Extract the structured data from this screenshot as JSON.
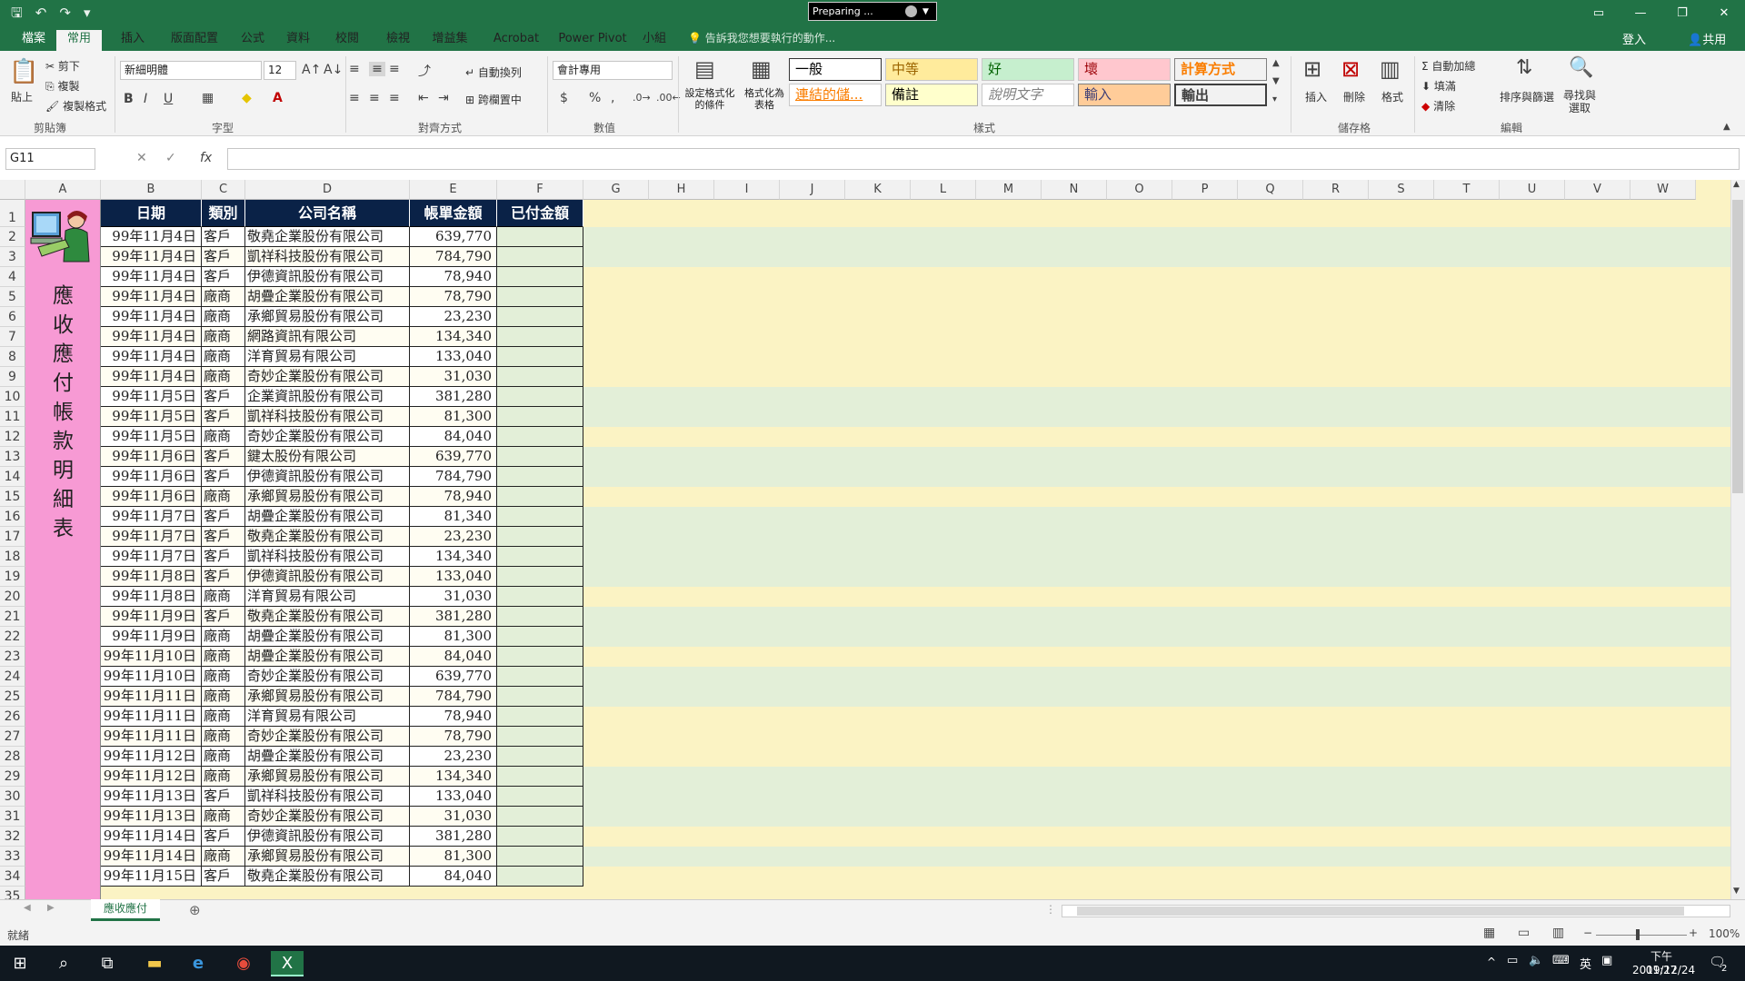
{
  "titlebar": {
    "preparing": "Preparing ...",
    "qat": [
      "save-icon",
      "undo-icon",
      "redo-icon",
      "customize-icon"
    ]
  },
  "tabs": [
    "檔案",
    "常用",
    "插入",
    "版面配置",
    "公式",
    "資料",
    "校閱",
    "檢視",
    "增益集",
    "Acrobat",
    "Power Pivot",
    "小組"
  ],
  "active_tab": "常用",
  "tellme": "告訴我您想要執行的動作...",
  "login": "登入",
  "share": "共用",
  "ribbon": {
    "clipboard": {
      "paste": "貼上",
      "cut": "剪下",
      "copy": "複製",
      "format_painter": "複製格式",
      "label": "剪貼簿"
    },
    "font": {
      "name": "新細明體",
      "size": "12",
      "bold": "B",
      "italic": "I",
      "underline": "U",
      "label": "字型"
    },
    "alignment": {
      "wrap": "自動換列",
      "merge": "跨欄置中",
      "label": "對齊方式"
    },
    "number": {
      "format": "會計專用",
      "currency": "$",
      "percent": "%",
      "comma": ",",
      "label": "數值"
    },
    "styles": {
      "conditional": "設定格式化的條件",
      "as_table": "格式化為表格",
      "cells": [
        "一般",
        "中等",
        "好",
        "壞",
        "計算方式",
        "連結的儲...",
        "備註",
        "說明文字",
        "輸入",
        "輸出"
      ],
      "label": "樣式"
    },
    "cells_group": {
      "insert": "插入",
      "delete": "刪除",
      "format": "格式",
      "label": "儲存格"
    },
    "editing": {
      "autosum": "自動加總",
      "fill": "填滿",
      "clear": "清除",
      "sort": "排序與篩選",
      "find": "尋找與選取",
      "label": "編輯"
    }
  },
  "namebox": "G11",
  "fx_label": "fx",
  "columns": [
    "A",
    "B",
    "C",
    "D",
    "E",
    "F",
    "G",
    "H",
    "I",
    "J",
    "K",
    "L",
    "M",
    "N",
    "O",
    "P",
    "Q",
    "R",
    "S",
    "T",
    "U",
    "V",
    "W"
  ],
  "side_title": "應收應付帳款明細表",
  "table_headers": [
    "日期",
    "類別",
    "公司名稱",
    "帳單金額",
    "已付金額"
  ],
  "rows": [
    [
      "99年11月4日",
      "客戶",
      "敬堯企業股份有限公司",
      "639,770"
    ],
    [
      "99年11月4日",
      "客戶",
      "凱祥科技股份有限公司",
      "784,790"
    ],
    [
      "99年11月4日",
      "客戶",
      "伊德資訊股份有限公司",
      "78,940"
    ],
    [
      "99年11月4日",
      "廠商",
      "胡疊企業股份有限公司",
      "78,790"
    ],
    [
      "99年11月4日",
      "廠商",
      "承鄉貿易股份有限公司",
      "23,230"
    ],
    [
      "99年11月4日",
      "廠商",
      "網路資訊有限公司",
      "134,340"
    ],
    [
      "99年11月4日",
      "廠商",
      "洋育貿易有限公司",
      "133,040"
    ],
    [
      "99年11月4日",
      "廠商",
      "奇妙企業股份有限公司",
      "31,030"
    ],
    [
      "99年11月5日",
      "客戶",
      "企業資訊股份有限公司",
      "381,280"
    ],
    [
      "99年11月5日",
      "客戶",
      "凱祥科技股份有限公司",
      "81,300"
    ],
    [
      "99年11月5日",
      "廠商",
      "奇妙企業股份有限公司",
      "84,040"
    ],
    [
      "99年11月6日",
      "客戶",
      "鍵太股份有限公司",
      "639,770"
    ],
    [
      "99年11月6日",
      "客戶",
      "伊德資訊股份有限公司",
      "784,790"
    ],
    [
      "99年11月6日",
      "廠商",
      "承鄉貿易股份有限公司",
      "78,940"
    ],
    [
      "99年11月7日",
      "客戶",
      "胡疊企業股份有限公司",
      "81,340"
    ],
    [
      "99年11月7日",
      "客戶",
      "敬堯企業股份有限公司",
      "23,230"
    ],
    [
      "99年11月7日",
      "客戶",
      "凱祥科技股份有限公司",
      "134,340"
    ],
    [
      "99年11月8日",
      "客戶",
      "伊德資訊股份有限公司",
      "133,040"
    ],
    [
      "99年11月8日",
      "廠商",
      "洋育貿易有限公司",
      "31,030"
    ],
    [
      "99年11月9日",
      "客戶",
      "敬堯企業股份有限公司",
      "381,280"
    ],
    [
      "99年11月9日",
      "廠商",
      "胡疊企業股份有限公司",
      "81,300"
    ],
    [
      "99年11月10日",
      "廠商",
      "胡疊企業股份有限公司",
      "84,040"
    ],
    [
      "99年11月10日",
      "廠商",
      "奇妙企業股份有限公司",
      "639,770"
    ],
    [
      "99年11月11日",
      "廠商",
      "承鄉貿易股份有限公司",
      "784,790"
    ],
    [
      "99年11月11日",
      "廠商",
      "洋育貿易有限公司",
      "78,940"
    ],
    [
      "99年11月11日",
      "廠商",
      "奇妙企業股份有限公司",
      "78,790"
    ],
    [
      "99年11月12日",
      "廠商",
      "胡疊企業股份有限公司",
      "23,230"
    ],
    [
      "99年11月12日",
      "廠商",
      "承鄉貿易股份有限公司",
      "134,340"
    ],
    [
      "99年11月13日",
      "客戶",
      "凱祥科技股份有限公司",
      "133,040"
    ],
    [
      "99年11月13日",
      "廠商",
      "奇妙企業股份有限公司",
      "31,030"
    ],
    [
      "99年11月14日",
      "客戶",
      "伊德資訊股份有限公司",
      "381,280"
    ],
    [
      "99年11月14日",
      "廠商",
      "承鄉貿易股份有限公司",
      "81,300"
    ],
    [
      "99年11月15日",
      "客戶",
      "敬堯企業股份有限公司",
      "84,040"
    ]
  ],
  "sheet_tab": "應收應付",
  "status": "就緒",
  "zoom": "100%",
  "clock": {
    "time": "下午 01:27",
    "date": "2019/12/24"
  },
  "ime": "英",
  "notif_count": "2",
  "colors": {
    "excel_green": "#217346",
    "header_navy": "#0a2247",
    "pink": "#f79ad4",
    "band_yellow": "#fbf3c4",
    "band_green": "#e3efd8"
  }
}
